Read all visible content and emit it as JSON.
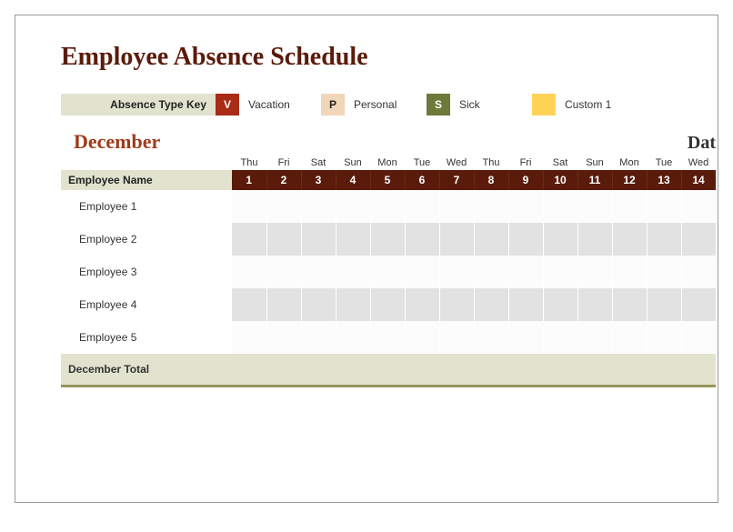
{
  "title": "Employee Absence Schedule",
  "legend": {
    "label": "Absence Type Key",
    "items": [
      {
        "code": "V",
        "label": "Vacation",
        "color": "#a82c16",
        "textcolor": "#ffffff"
      },
      {
        "code": "P",
        "label": "Personal",
        "color": "#f2d6b8",
        "textcolor": "#333333"
      },
      {
        "code": "S",
        "label": "Sick",
        "color": "#6d7a3a",
        "textcolor": "#ffffff"
      },
      {
        "code": "",
        "label": "Custom 1",
        "color": "#ffd257",
        "textcolor": "#333333"
      }
    ]
  },
  "month": "December",
  "dates_label": "Dat",
  "columns": {
    "name_header": "Employee Name",
    "days": [
      {
        "dow": "Thu",
        "num": "1"
      },
      {
        "dow": "Fri",
        "num": "2"
      },
      {
        "dow": "Sat",
        "num": "3"
      },
      {
        "dow": "Sun",
        "num": "4"
      },
      {
        "dow": "Mon",
        "num": "5"
      },
      {
        "dow": "Tue",
        "num": "6"
      },
      {
        "dow": "Wed",
        "num": "7"
      },
      {
        "dow": "Thu",
        "num": "8"
      },
      {
        "dow": "Fri",
        "num": "9"
      },
      {
        "dow": "Sat",
        "num": "10"
      },
      {
        "dow": "Sun",
        "num": "11"
      },
      {
        "dow": "Mon",
        "num": "12"
      },
      {
        "dow": "Tue",
        "num": "13"
      },
      {
        "dow": "Wed",
        "num": "14"
      }
    ]
  },
  "employees": [
    {
      "name": "Employee 1"
    },
    {
      "name": "Employee 2"
    },
    {
      "name": "Employee 3"
    },
    {
      "name": "Employee 4"
    },
    {
      "name": "Employee 5"
    }
  ],
  "total_label": "December Total"
}
